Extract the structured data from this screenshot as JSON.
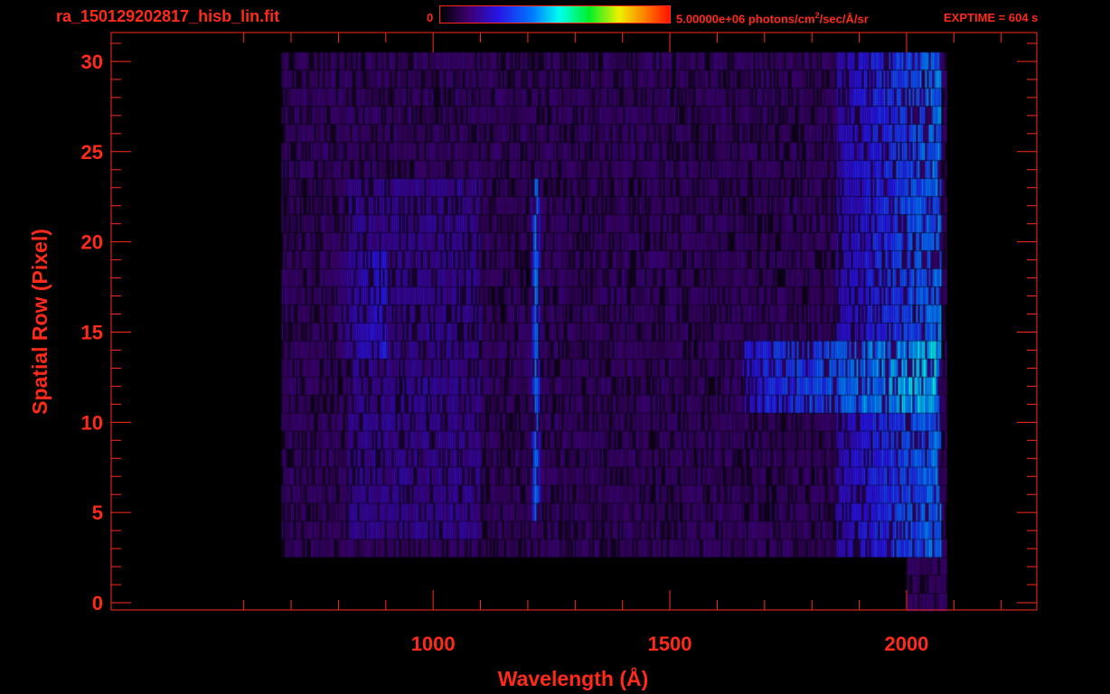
{
  "header": {
    "filename": "ra_150129202817_hisb_lin.fit",
    "colorbar_min_label": "0",
    "colorbar_max_label_pre": "5.00000e+06 photons/cm",
    "colorbar_max_label_sup": "2",
    "colorbar_max_label_post": "/sec/Å/sr",
    "exptime_label": "EXPTIME = 604 s"
  },
  "colors": {
    "text": "#ff2a1a",
    "axes": "#ff2a1a",
    "background": "#000000"
  },
  "chart_data": {
    "type": "heatmap",
    "title": "ra_150129202817_hisb_lin.fit",
    "xlabel": "Wavelength (Å)",
    "ylabel": "Spatial Row (Pixel)",
    "xlim": [
      320,
      2275
    ],
    "ylim": [
      -0.4,
      31.6
    ],
    "xticks": [
      1000,
      1500,
      2000
    ],
    "xticks_minor": [
      600,
      700,
      800,
      900,
      1100,
      1200,
      1300,
      1400,
      1600,
      1700,
      1800,
      1900,
      2100,
      2200
    ],
    "yticks": [
      0,
      5,
      10,
      15,
      20,
      25,
      30
    ],
    "colormap": "rainbow (black→purple→blue→cyan→green→yellow→orange→red)",
    "color_range": [
      0,
      5000000
    ],
    "color_unit": "photons/cm^2/sec/Å/sr",
    "data_extent_x": [
      680,
      2085
    ],
    "data_rows_y": [
      0,
      30
    ],
    "features": [
      {
        "name": "Lyman-alpha emission line",
        "x": 1216,
        "rows": [
          5,
          23
        ],
        "relative_intensity": 0.42
      },
      {
        "name": "bright continuum band",
        "x_range": [
          1650,
          2060
        ],
        "rows": [
          11,
          14
        ],
        "relative_intensity": 0.55
      },
      {
        "name": "blob near 800 Å",
        "x_range": [
          790,
          900
        ],
        "rows": [
          14,
          19
        ],
        "relative_intensity": 0.3
      },
      {
        "name": "red-end brightening",
        "x_range": [
          1850,
          2070
        ],
        "rows": [
          3,
          30
        ],
        "relative_intensity": 0.45
      }
    ]
  }
}
